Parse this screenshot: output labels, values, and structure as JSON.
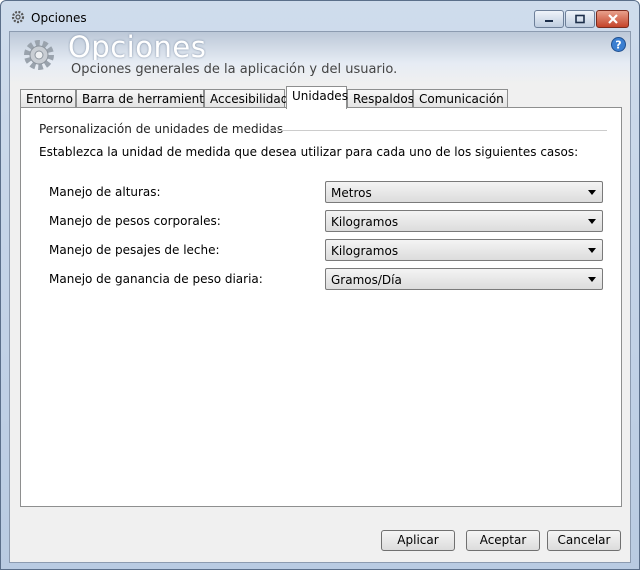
{
  "window": {
    "title": "Opciones",
    "help_icon": "help-icon",
    "controls": [
      "minimize-icon",
      "maximize-icon",
      "close-icon"
    ]
  },
  "header": {
    "title": "Opciones",
    "subtitle": "Opciones generales de la aplicación y del usuario.",
    "icon": "gear-icon"
  },
  "tabs": [
    {
      "label": "Entorno"
    },
    {
      "label": "Barra de herramientas"
    },
    {
      "label": "Accesibilidad"
    },
    {
      "label": "Unidades",
      "active": true
    },
    {
      "label": "Respaldos"
    },
    {
      "label": "Comunicación"
    }
  ],
  "units": {
    "group_title": "Personalización de unidades de medidas",
    "intro": "Establezca la unidad de medida que desea utilizar para cada uno de los siguientes casos:",
    "rows": [
      {
        "label": "Manejo de alturas:",
        "value": "Metros"
      },
      {
        "label": "Manejo de pesos corporales:",
        "value": "Kilogramos"
      },
      {
        "label": "Manejo de pesajes de leche:",
        "value": "Kilogramos"
      },
      {
        "label": "Manejo de ganancia de peso diaria:",
        "value": "Gramos/Día"
      }
    ]
  },
  "buttons": {
    "apply": "Aplicar",
    "accept": "Aceptar",
    "cancel": "Cancelar"
  }
}
